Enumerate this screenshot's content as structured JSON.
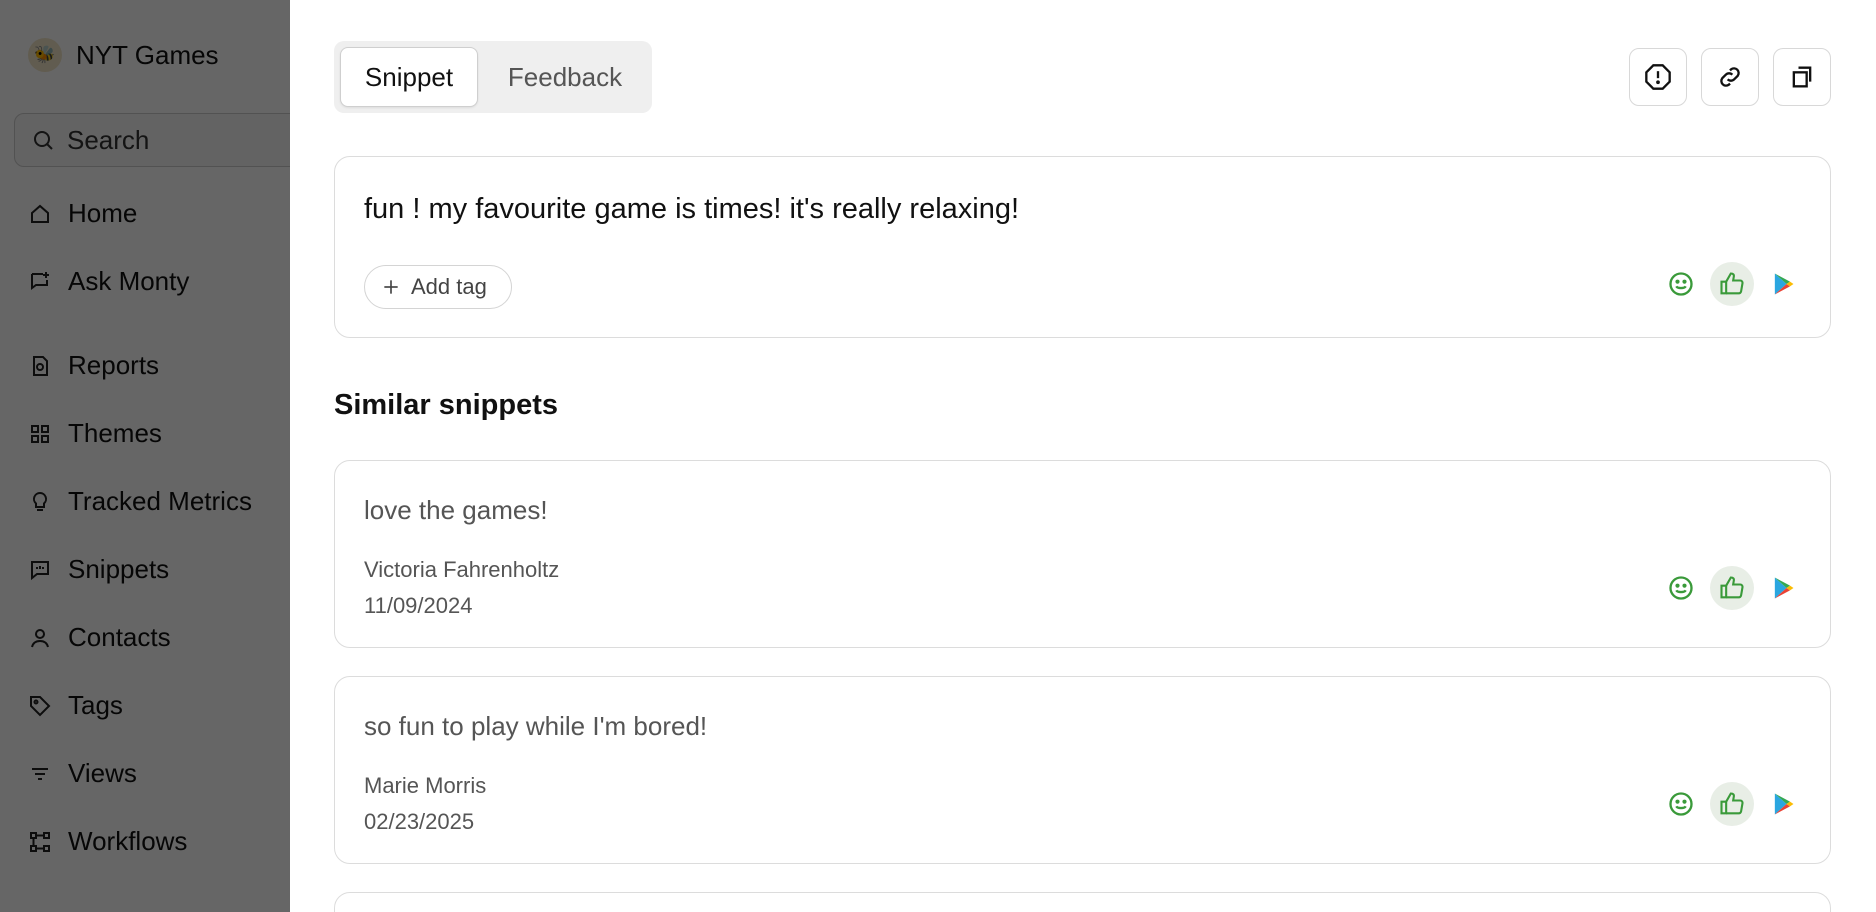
{
  "sidebar": {
    "brand": {
      "name": "NYT Games",
      "logo_icon": "bee-icon"
    },
    "search": {
      "label": "Search"
    },
    "items": [
      {
        "label": "Home",
        "icon": "home-icon"
      },
      {
        "label": "Ask Monty",
        "icon": "chat-plus-icon"
      },
      {
        "label": "Reports",
        "icon": "report-icon"
      },
      {
        "label": "Themes",
        "icon": "grid-icon"
      },
      {
        "label": "Tracked Metrics",
        "icon": "lightbulb-icon"
      },
      {
        "label": "Snippets",
        "icon": "message-icon"
      },
      {
        "label": "Contacts",
        "icon": "person-icon"
      },
      {
        "label": "Tags",
        "icon": "tag-icon"
      },
      {
        "label": "Views",
        "icon": "filter-icon"
      },
      {
        "label": "Workflows",
        "icon": "workflow-icon"
      }
    ]
  },
  "panel": {
    "tabs": [
      {
        "label": "Snippet",
        "active": true
      },
      {
        "label": "Feedback",
        "active": false
      }
    ],
    "toolbar_icons": [
      "report-issue-icon",
      "link-icon",
      "copy-icon"
    ],
    "snippet": {
      "text": "fun ! my favourite game is times! it's really relaxing!",
      "add_tag_label": "Add tag"
    },
    "similar_title": "Similar snippets",
    "similar": [
      {
        "text": "love the games!",
        "author": "Victoria Fahrenholtz",
        "date": "11/09/2024"
      },
      {
        "text": "so fun to play while I'm bored!",
        "author": "Marie Morris",
        "date": "02/23/2025"
      }
    ],
    "colors": {
      "sentiment_green": "#3a9a3a",
      "thumb_bg": "#e8eee6",
      "overlay": "rgba(0,0,0,0.6)"
    }
  }
}
